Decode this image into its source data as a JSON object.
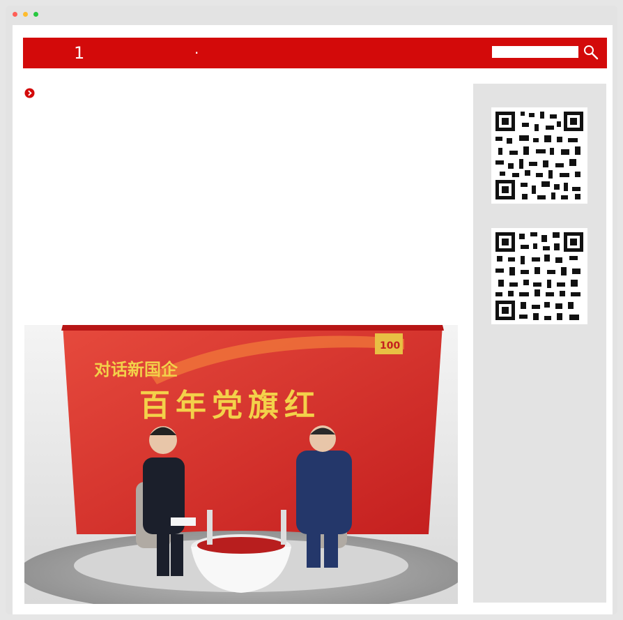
{
  "window": {
    "traffic_lights": [
      "#ff5f57",
      "#febc2e",
      "#28c840"
    ]
  },
  "header": {
    "number": "1",
    "separator": "·",
    "search_placeholder": "",
    "brand_color": "#d30a0a"
  },
  "article": {
    "bullet_icon": "circle-chevron-right-icon",
    "photo": {
      "banner_title_small": "对话新国企",
      "banner_title_large": "百年党旗红",
      "badge": "100"
    }
  },
  "sidebar": {
    "qr_codes": [
      "qr-code-1",
      "qr-code-2"
    ]
  }
}
